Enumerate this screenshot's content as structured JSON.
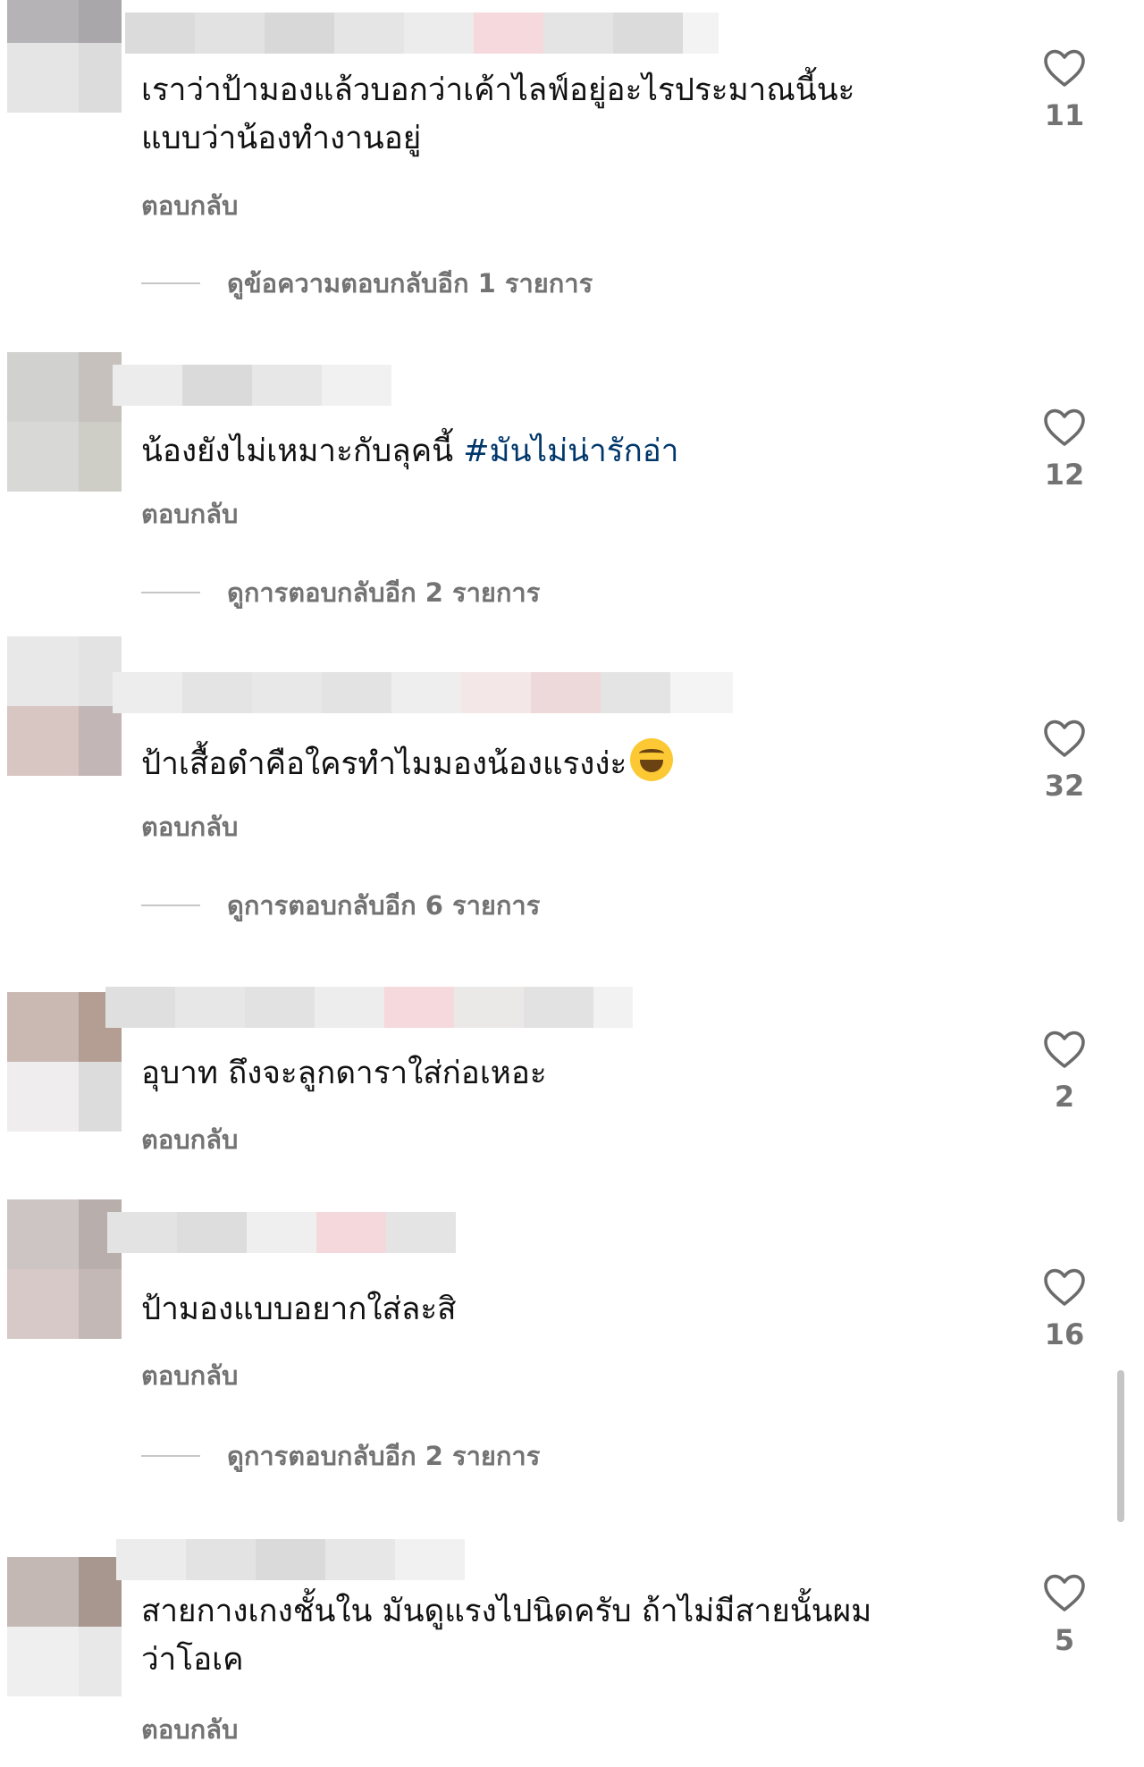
{
  "comments": [
    {
      "text_lines": [
        "เราว่าป้ามองแล้วบอกว่าเค้าไลฟ์อยู่อะไรประมาณนี้นะ",
        "แบบว่าน้องทำงานอยู่"
      ],
      "reply_label": "ตอบกลับ",
      "likes": "11",
      "view_replies": "ดูข้อความตอบกลับอีก 1 รายการ"
    },
    {
      "text": "น้องยังไม่เหมาะกับลุคนี้ ",
      "hashtag": "#มันไม่น่ารักอ่า",
      "reply_label": "ตอบกลับ",
      "likes": "12",
      "view_replies": "ดูการตอบกลับอีก 2 รายการ"
    },
    {
      "text": "ป้าเสื้อดำคือใครทำไมมองน้องแรงง่ะ",
      "emoji": "face-with-tears-of-joy",
      "reply_label": "ตอบกลับ",
      "likes": "32",
      "view_replies": "ดูการตอบกลับอีก 6 รายการ"
    },
    {
      "text": "อุบาท ถึงจะลูกดาราใส่ก่อเหอะ",
      "reply_label": "ตอบกลับ",
      "likes": "2"
    },
    {
      "text": "ป้ามองแบบอยากใส่ละสิ",
      "reply_label": "ตอบกลับ",
      "likes": "16",
      "view_replies": "ดูการตอบกลับอีก 2 รายการ"
    },
    {
      "text_lines": [
        "สายกางเกงชั้นใน มันดูแรงไปนิดครับ ถ้าไม่มีสายนั้นผม",
        "ว่าโอเค"
      ],
      "reply_label": "ตอบกลับ",
      "likes": "5"
    }
  ],
  "icons": {
    "like": "heart-outline-icon"
  },
  "colors": {
    "text": "#111111",
    "muted": "#737373",
    "hashtag": "#00376b"
  }
}
